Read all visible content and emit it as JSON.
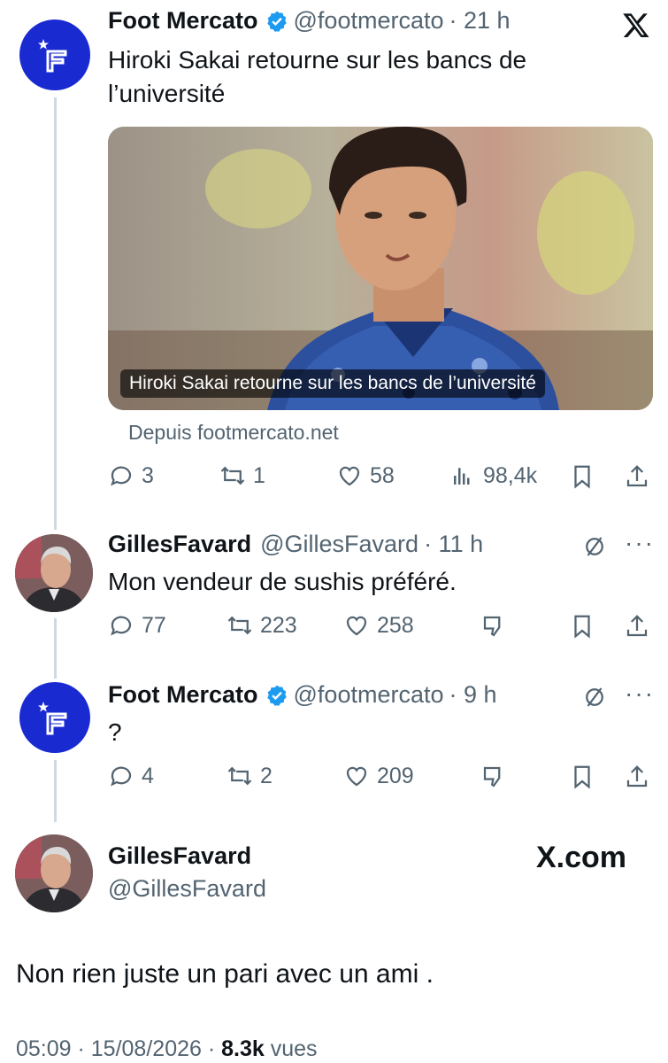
{
  "colors": {
    "accent": "#1d9bf0",
    "foot_mercato_blue": "#1a2ad1",
    "muted": "#536471"
  },
  "tweet1": {
    "name": "Foot Mercato",
    "handle": "@footmercato",
    "time": "· 21 h",
    "text": "Hiroki Sakai retourne sur les bancs de l’université",
    "media_caption": "Hiroki Sakai retourne sur les bancs de l’université",
    "source": "Depuis footmercato.net",
    "replies": "3",
    "retweets": "1",
    "likes": "58",
    "views": "98,4k"
  },
  "reply1": {
    "name": "GillesFavard",
    "handle": "@GillesFavard",
    "time": "· 11 h",
    "text": "Mon vendeur de sushis préféré.",
    "replies": "77",
    "retweets": "223",
    "likes": "258"
  },
  "reply2": {
    "name": "Foot Mercato",
    "handle": "@footmercato",
    "time": "· 9 h",
    "text": "?",
    "replies": "4",
    "retweets": "2",
    "likes": "209"
  },
  "main": {
    "name": "GillesFavard",
    "handle": "@GillesFavard",
    "brand": "X.com",
    "text": "Non rien juste un pari avec un ami .",
    "date": "05:09 · 15/08/2026 ·",
    "views_count": "8.3k",
    "views_label": "vues"
  },
  "icons": [
    "x-logo-icon",
    "verified-badge-icon",
    "reply-icon",
    "retweet-icon",
    "like-icon",
    "views-icon",
    "bookmark-icon",
    "share-icon",
    "not-interested-icon",
    "more-icon",
    "dislike-icon"
  ]
}
